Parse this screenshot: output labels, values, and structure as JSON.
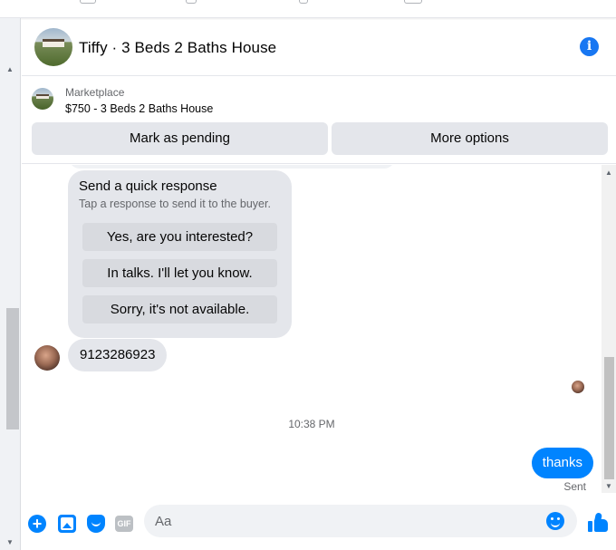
{
  "conversation": {
    "title": "Tiffy · 3 Beds 2 Baths House"
  },
  "listing": {
    "source": "Marketplace",
    "item": "$750 - 3 Beds 2 Baths House",
    "actions": {
      "mark_pending": "Mark as pending",
      "more_options": "More options"
    }
  },
  "quick_response": {
    "title": "Send a quick response",
    "subtitle": "Tap a response to send it to the buyer.",
    "options": [
      "Yes, are you interested?",
      "In talks. I'll let you know.",
      "Sorry, it's not available."
    ]
  },
  "messages": {
    "received": "9123286923",
    "timestamp": "10:38 PM",
    "sent": "thanks",
    "sent_status": "Sent"
  },
  "composer": {
    "placeholder": "Aa",
    "gif_label": "GIF"
  },
  "icons": {
    "info": "info-icon",
    "plus": "plus-icon",
    "photo": "photo-icon",
    "sticker": "sticker-icon",
    "gif": "gif-icon",
    "emoji": "emoji-icon",
    "like": "thumbs-up-icon"
  },
  "colors": {
    "accent": "#0084ff",
    "info_blue": "#1877f2",
    "bubble_gray": "#e4e6eb",
    "muted_text": "#65676b"
  }
}
